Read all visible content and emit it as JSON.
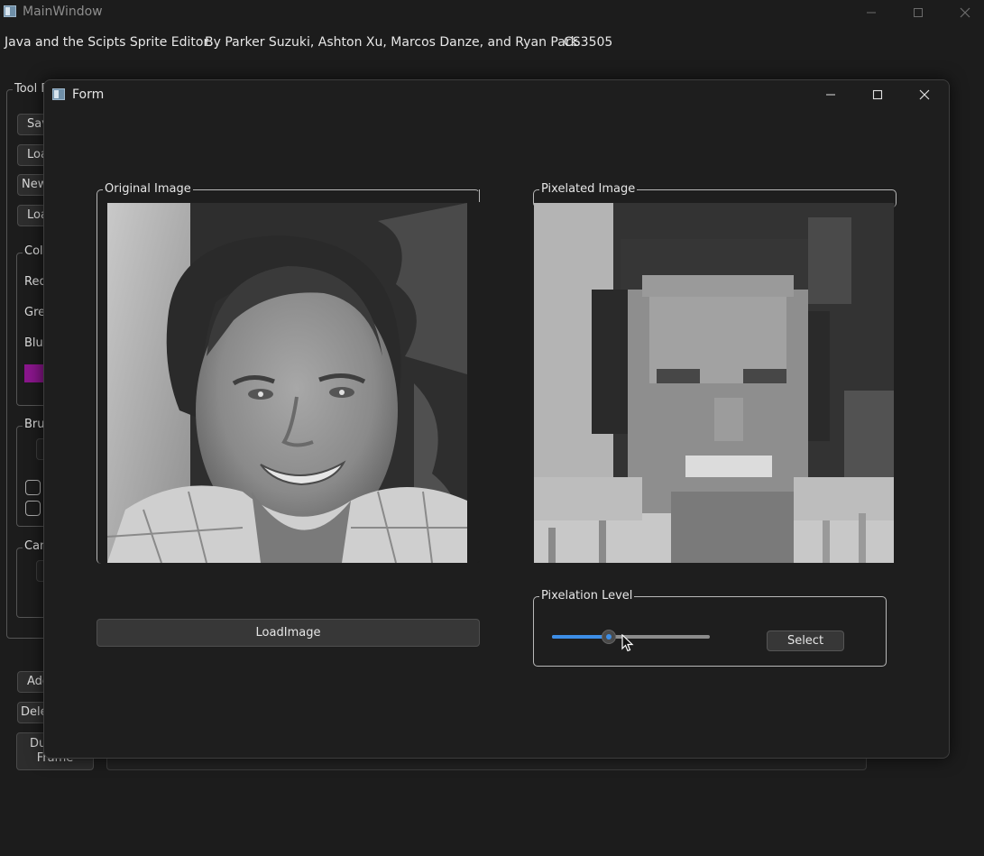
{
  "main_window": {
    "title": "MainWindow",
    "header": {
      "app_name": "Java and the Scipts Sprite Editor",
      "authors": "By Parker Suzuki, Ashton Xu, Marcos Danze, and Ryan Park",
      "course": "CS3505"
    },
    "tool_group_title": "Tool E",
    "tool_buttons": [
      "Sav",
      "Loa",
      "New",
      "Loa"
    ],
    "color_group_title": "Colo",
    "color_labels": [
      "Red",
      "Gre",
      "Blue"
    ],
    "swatch_color": "#8a168c",
    "brush_group_title": "Brus",
    "canvas_group_title": "Can",
    "frame_buttons": [
      "Add",
      "Dele"
    ],
    "duplicate_button": [
      "Du",
      "Frame"
    ]
  },
  "form": {
    "title": "Form",
    "original_group_title": "Original Image",
    "pixelated_group_title": "Pixelated Image",
    "load_button_label": "LoadImage",
    "pixelation_group_title": "Pixelation Level",
    "select_button_label": "Select",
    "pixelation_level": 0.36,
    "accent_color": "#3d8ee6"
  },
  "icons": {
    "minimize": "minimize-icon",
    "maximize": "maximize-icon",
    "close": "close-icon",
    "app": "app-icon",
    "cursor": "mouse-cursor-icon"
  }
}
